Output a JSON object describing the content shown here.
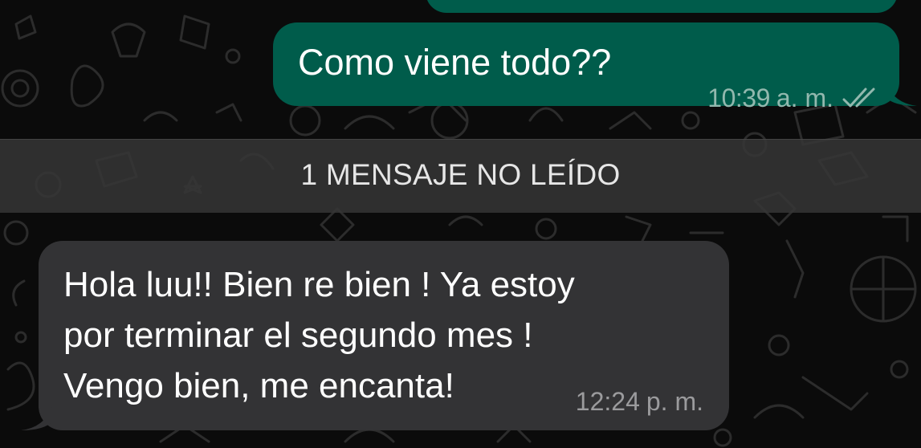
{
  "colors": {
    "background": "#0b0b0b",
    "outgoing_bubble": "#005c4b",
    "incoming_bubble": "#333335",
    "unread_bar": "#363636",
    "outgoing_meta": "#92b8ae",
    "incoming_meta": "#9b9b9d"
  },
  "chat": {
    "outgoing": {
      "text": "Como viene todo??",
      "time": "10:39",
      "ampm": "a. m.",
      "status_icon": "double-check-icon"
    },
    "unread_divider": {
      "label": "1 MENSAJE NO LEÍDO"
    },
    "incoming": {
      "lines": [
        "Hola luu!! Bien re bien ! Ya estoy",
        "por terminar el segundo mes !",
        "Vengo bien, me encanta!"
      ],
      "time": "12:24",
      "ampm": "p. m."
    }
  }
}
